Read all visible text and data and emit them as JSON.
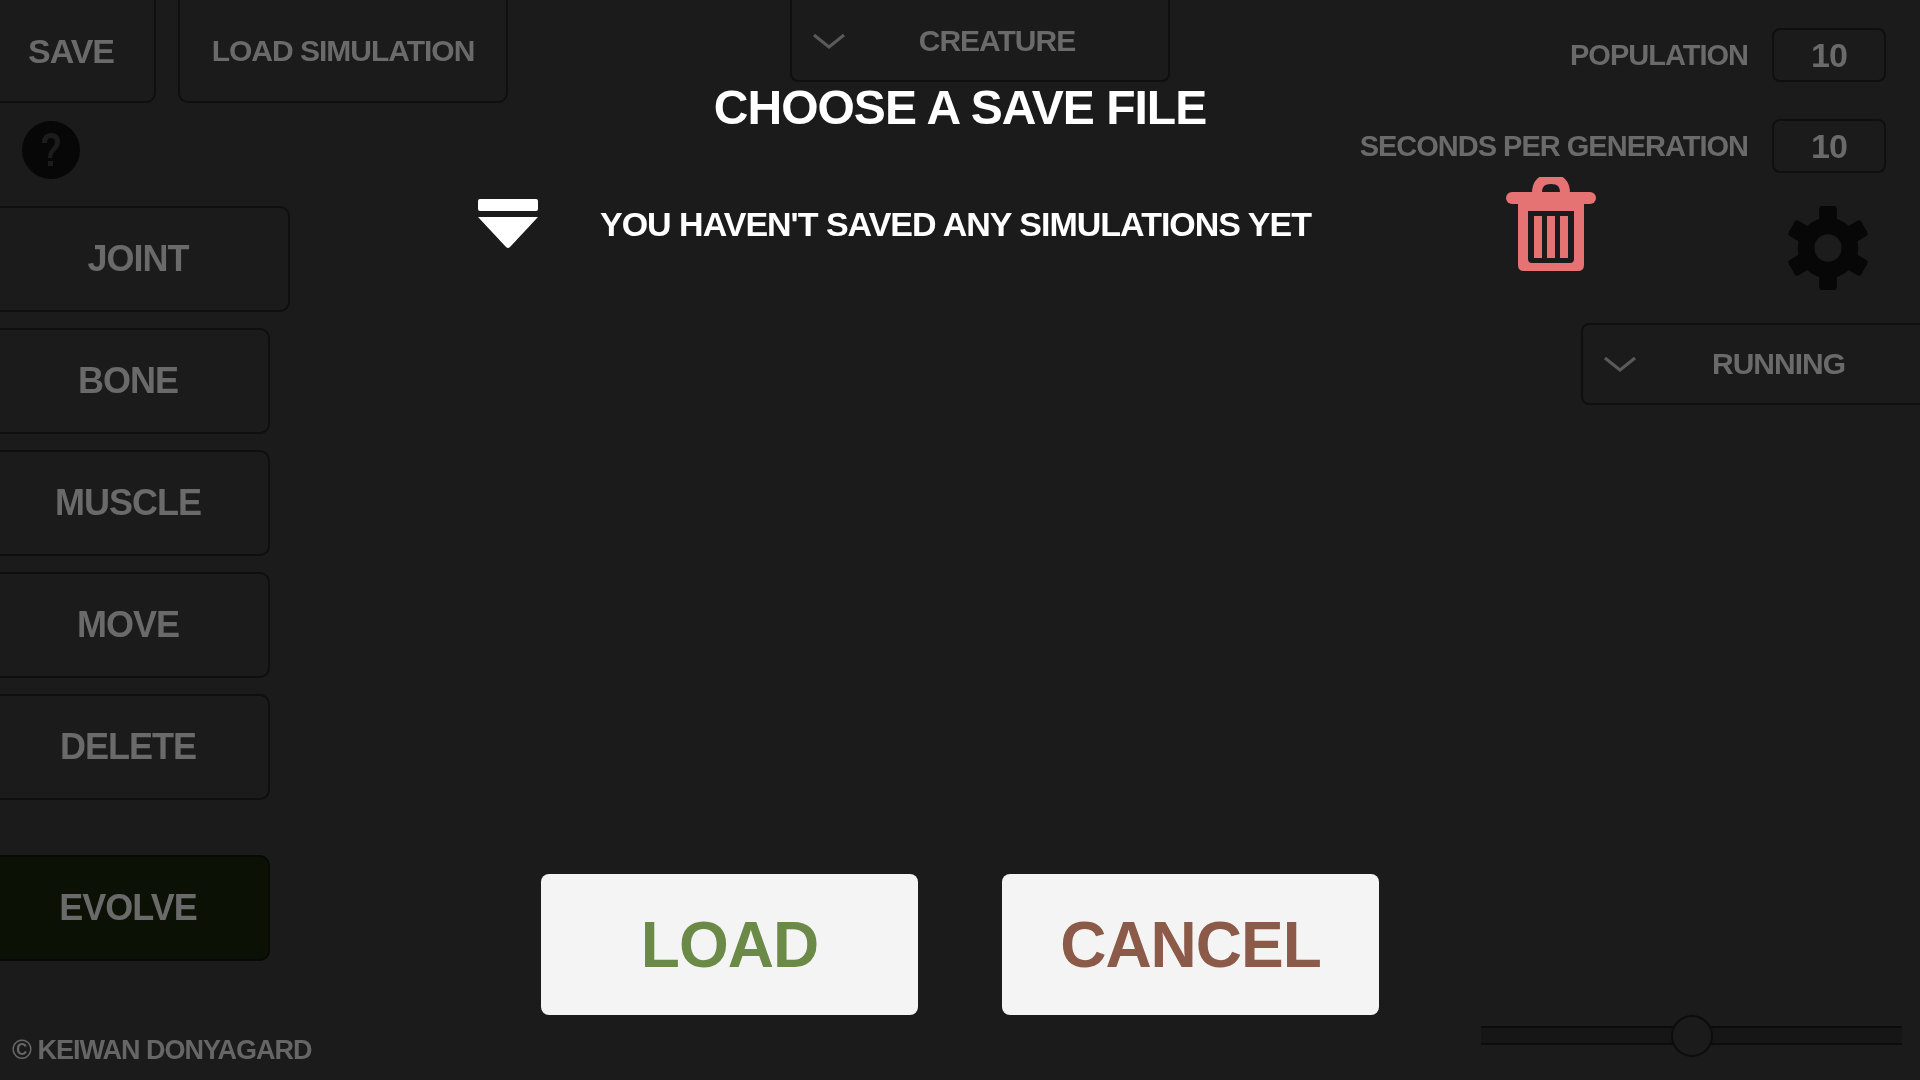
{
  "toolbar": {
    "buttons": [
      {
        "label": "SAVE"
      },
      {
        "label": "LOAD SIMULATION"
      }
    ]
  },
  "tools": [
    {
      "label": "JOINT",
      "kind": "tool"
    },
    {
      "label": "BONE",
      "kind": "tool"
    },
    {
      "label": "MUSCLE",
      "kind": "tool"
    },
    {
      "label": "MOVE",
      "kind": "tool"
    },
    {
      "label": "DELETE",
      "kind": "tool"
    },
    {
      "label": "EVOLVE",
      "kind": "action"
    }
  ],
  "copyright": "© KEIWAN DONYAGARD",
  "creature_dropdown": {
    "value": "CREATURE"
  },
  "settings": [
    {
      "label": "POPULATION",
      "value": "10"
    },
    {
      "label": "SECONDS PER GENERATION",
      "value": "10"
    }
  ],
  "task_dropdown": {
    "value": "RUNNING"
  },
  "speed_slider": {
    "level": 0.5
  },
  "dialog": {
    "title": "CHOOSE A SAVE FILE",
    "message": "YOU HAVEN'T SAVED ANY SIMULATIONS YET",
    "buttons": [
      {
        "label": "LOAD",
        "kind": "confirm"
      },
      {
        "label": "CANCEL",
        "kind": "cancel"
      }
    ]
  }
}
